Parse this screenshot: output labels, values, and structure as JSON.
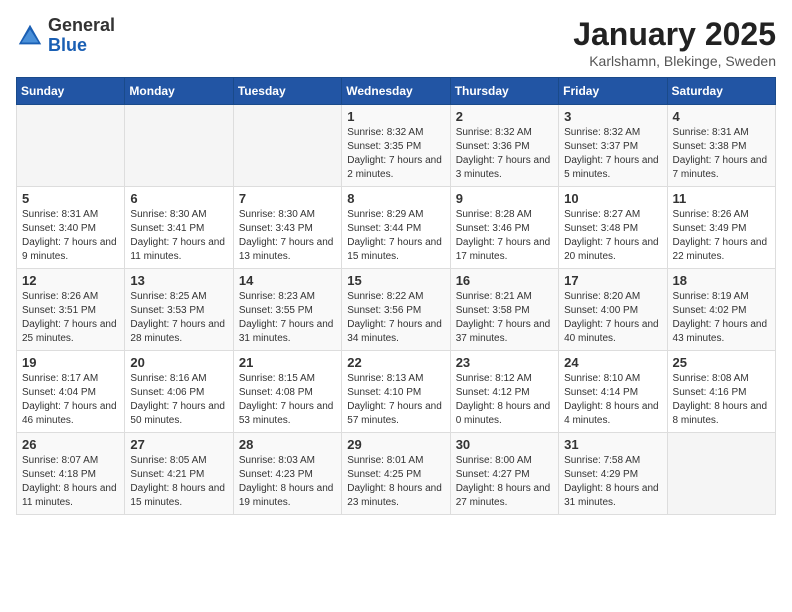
{
  "header": {
    "logo_general": "General",
    "logo_blue": "Blue",
    "month": "January 2025",
    "location": "Karlshamn, Blekinge, Sweden"
  },
  "weekdays": [
    "Sunday",
    "Monday",
    "Tuesday",
    "Wednesday",
    "Thursday",
    "Friday",
    "Saturday"
  ],
  "weeks": [
    [
      {
        "day": "",
        "sunrise": "",
        "sunset": "",
        "daylight": ""
      },
      {
        "day": "",
        "sunrise": "",
        "sunset": "",
        "daylight": ""
      },
      {
        "day": "",
        "sunrise": "",
        "sunset": "",
        "daylight": ""
      },
      {
        "day": "1",
        "sunrise": "Sunrise: 8:32 AM",
        "sunset": "Sunset: 3:35 PM",
        "daylight": "Daylight: 7 hours and 2 minutes."
      },
      {
        "day": "2",
        "sunrise": "Sunrise: 8:32 AM",
        "sunset": "Sunset: 3:36 PM",
        "daylight": "Daylight: 7 hours and 3 minutes."
      },
      {
        "day": "3",
        "sunrise": "Sunrise: 8:32 AM",
        "sunset": "Sunset: 3:37 PM",
        "daylight": "Daylight: 7 hours and 5 minutes."
      },
      {
        "day": "4",
        "sunrise": "Sunrise: 8:31 AM",
        "sunset": "Sunset: 3:38 PM",
        "daylight": "Daylight: 7 hours and 7 minutes."
      }
    ],
    [
      {
        "day": "5",
        "sunrise": "Sunrise: 8:31 AM",
        "sunset": "Sunset: 3:40 PM",
        "daylight": "Daylight: 7 hours and 9 minutes."
      },
      {
        "day": "6",
        "sunrise": "Sunrise: 8:30 AM",
        "sunset": "Sunset: 3:41 PM",
        "daylight": "Daylight: 7 hours and 11 minutes."
      },
      {
        "day": "7",
        "sunrise": "Sunrise: 8:30 AM",
        "sunset": "Sunset: 3:43 PM",
        "daylight": "Daylight: 7 hours and 13 minutes."
      },
      {
        "day": "8",
        "sunrise": "Sunrise: 8:29 AM",
        "sunset": "Sunset: 3:44 PM",
        "daylight": "Daylight: 7 hours and 15 minutes."
      },
      {
        "day": "9",
        "sunrise": "Sunrise: 8:28 AM",
        "sunset": "Sunset: 3:46 PM",
        "daylight": "Daylight: 7 hours and 17 minutes."
      },
      {
        "day": "10",
        "sunrise": "Sunrise: 8:27 AM",
        "sunset": "Sunset: 3:48 PM",
        "daylight": "Daylight: 7 hours and 20 minutes."
      },
      {
        "day": "11",
        "sunrise": "Sunrise: 8:26 AM",
        "sunset": "Sunset: 3:49 PM",
        "daylight": "Daylight: 7 hours and 22 minutes."
      }
    ],
    [
      {
        "day": "12",
        "sunrise": "Sunrise: 8:26 AM",
        "sunset": "Sunset: 3:51 PM",
        "daylight": "Daylight: 7 hours and 25 minutes."
      },
      {
        "day": "13",
        "sunrise": "Sunrise: 8:25 AM",
        "sunset": "Sunset: 3:53 PM",
        "daylight": "Daylight: 7 hours and 28 minutes."
      },
      {
        "day": "14",
        "sunrise": "Sunrise: 8:23 AM",
        "sunset": "Sunset: 3:55 PM",
        "daylight": "Daylight: 7 hours and 31 minutes."
      },
      {
        "day": "15",
        "sunrise": "Sunrise: 8:22 AM",
        "sunset": "Sunset: 3:56 PM",
        "daylight": "Daylight: 7 hours and 34 minutes."
      },
      {
        "day": "16",
        "sunrise": "Sunrise: 8:21 AM",
        "sunset": "Sunset: 3:58 PM",
        "daylight": "Daylight: 7 hours and 37 minutes."
      },
      {
        "day": "17",
        "sunrise": "Sunrise: 8:20 AM",
        "sunset": "Sunset: 4:00 PM",
        "daylight": "Daylight: 7 hours and 40 minutes."
      },
      {
        "day": "18",
        "sunrise": "Sunrise: 8:19 AM",
        "sunset": "Sunset: 4:02 PM",
        "daylight": "Daylight: 7 hours and 43 minutes."
      }
    ],
    [
      {
        "day": "19",
        "sunrise": "Sunrise: 8:17 AM",
        "sunset": "Sunset: 4:04 PM",
        "daylight": "Daylight: 7 hours and 46 minutes."
      },
      {
        "day": "20",
        "sunrise": "Sunrise: 8:16 AM",
        "sunset": "Sunset: 4:06 PM",
        "daylight": "Daylight: 7 hours and 50 minutes."
      },
      {
        "day": "21",
        "sunrise": "Sunrise: 8:15 AM",
        "sunset": "Sunset: 4:08 PM",
        "daylight": "Daylight: 7 hours and 53 minutes."
      },
      {
        "day": "22",
        "sunrise": "Sunrise: 8:13 AM",
        "sunset": "Sunset: 4:10 PM",
        "daylight": "Daylight: 7 hours and 57 minutes."
      },
      {
        "day": "23",
        "sunrise": "Sunrise: 8:12 AM",
        "sunset": "Sunset: 4:12 PM",
        "daylight": "Daylight: 8 hours and 0 minutes."
      },
      {
        "day": "24",
        "sunrise": "Sunrise: 8:10 AM",
        "sunset": "Sunset: 4:14 PM",
        "daylight": "Daylight: 8 hours and 4 minutes."
      },
      {
        "day": "25",
        "sunrise": "Sunrise: 8:08 AM",
        "sunset": "Sunset: 4:16 PM",
        "daylight": "Daylight: 8 hours and 8 minutes."
      }
    ],
    [
      {
        "day": "26",
        "sunrise": "Sunrise: 8:07 AM",
        "sunset": "Sunset: 4:18 PM",
        "daylight": "Daylight: 8 hours and 11 minutes."
      },
      {
        "day": "27",
        "sunrise": "Sunrise: 8:05 AM",
        "sunset": "Sunset: 4:21 PM",
        "daylight": "Daylight: 8 hours and 15 minutes."
      },
      {
        "day": "28",
        "sunrise": "Sunrise: 8:03 AM",
        "sunset": "Sunset: 4:23 PM",
        "daylight": "Daylight: 8 hours and 19 minutes."
      },
      {
        "day": "29",
        "sunrise": "Sunrise: 8:01 AM",
        "sunset": "Sunset: 4:25 PM",
        "daylight": "Daylight: 8 hours and 23 minutes."
      },
      {
        "day": "30",
        "sunrise": "Sunrise: 8:00 AM",
        "sunset": "Sunset: 4:27 PM",
        "daylight": "Daylight: 8 hours and 27 minutes."
      },
      {
        "day": "31",
        "sunrise": "Sunrise: 7:58 AM",
        "sunset": "Sunset: 4:29 PM",
        "daylight": "Daylight: 8 hours and 31 minutes."
      },
      {
        "day": "",
        "sunrise": "",
        "sunset": "",
        "daylight": ""
      }
    ]
  ]
}
